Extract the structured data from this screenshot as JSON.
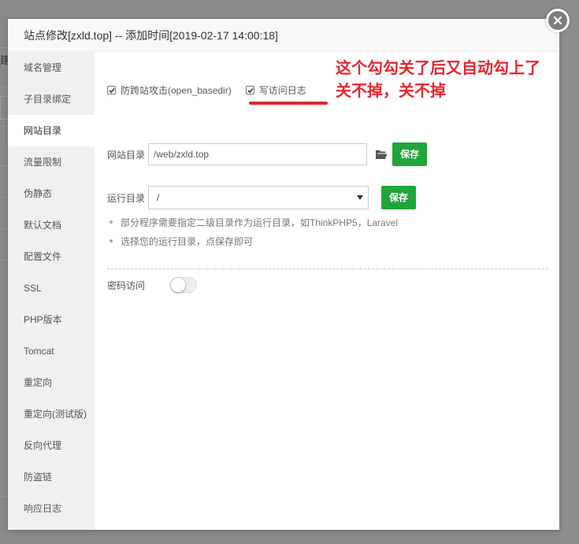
{
  "dialog": {
    "title": "站点修改[zxld.top] -- 添加时间[2019-02-17 14:00:18]"
  },
  "background": {
    "stub_text": "建"
  },
  "sidebar": {
    "items": [
      {
        "label": "域名管理"
      },
      {
        "label": "子目录绑定"
      },
      {
        "label": "网站目录"
      },
      {
        "label": "流量限制"
      },
      {
        "label": "伪静态"
      },
      {
        "label": "默认文档"
      },
      {
        "label": "配置文件"
      },
      {
        "label": "SSL"
      },
      {
        "label": "PHP版本"
      },
      {
        "label": "Tomcat"
      },
      {
        "label": "重定向"
      },
      {
        "label": "重定向(测试版)"
      },
      {
        "label": "反向代理"
      },
      {
        "label": "防盗链"
      },
      {
        "label": "响应日志"
      }
    ],
    "active_index": 2
  },
  "checkboxes": {
    "open_basedir": {
      "label": "防跨站攻击(open_basedir)",
      "checked": true
    },
    "access_log": {
      "label": "写访问日志",
      "checked": true
    }
  },
  "site_dir": {
    "label": "网站目录",
    "value": "/web/zxld.top",
    "save_label": "保存"
  },
  "run_dir": {
    "label": "运行目录",
    "value": "/",
    "save_label": "保存"
  },
  "tips": [
    "部分程序需要指定二级目录作为运行目录，如ThinkPHP5，Laravel",
    "选择您的运行目录，点保存即可"
  ],
  "password_access": {
    "label": "密码访问",
    "enabled": false
  },
  "annotation": {
    "line1": "这个勾勾关了后又自动勾上了",
    "line2": "关不掉，关不掉"
  },
  "colors": {
    "accent_green": "#20a53a",
    "annotation_red": "#e5262e"
  }
}
